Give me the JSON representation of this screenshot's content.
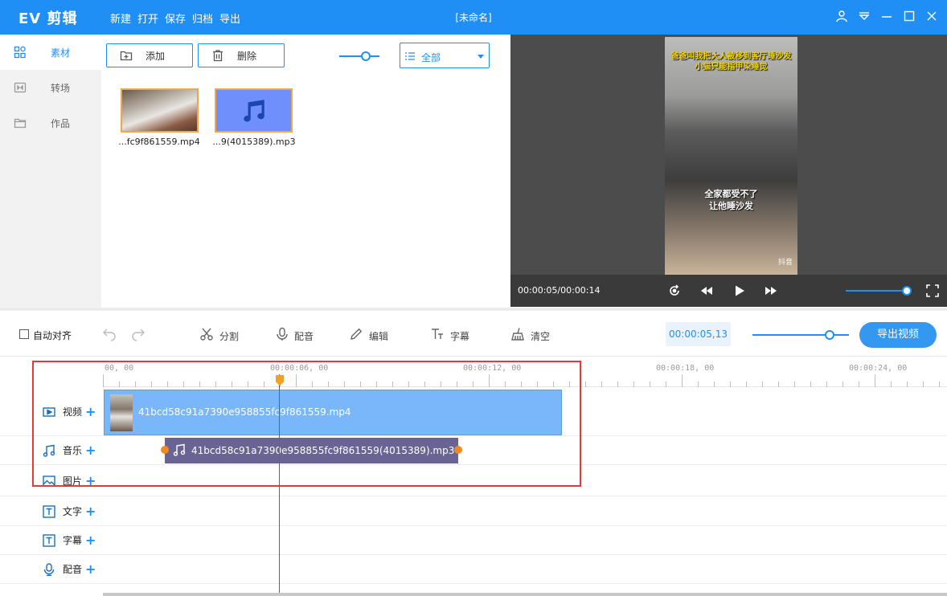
{
  "app": {
    "logo": "EV 剪辑",
    "doc_title": "[未命名]",
    "menu": [
      "新建",
      "打开",
      "保存",
      "归档",
      "导出"
    ]
  },
  "nav": {
    "items": [
      {
        "label": "素材",
        "icon": "grid-icon",
        "active": true
      },
      {
        "label": "转场",
        "icon": "transition-icon",
        "active": false
      },
      {
        "label": "作品",
        "icon": "folder-icon",
        "active": false
      }
    ]
  },
  "media": {
    "add_label": "添加",
    "delete_label": "删除",
    "filter_value": "全部",
    "thumb_size_level": 0.65,
    "files": [
      {
        "caption": "...fc9f861559.mp4",
        "type": "video"
      },
      {
        "caption": "...9(4015389).mp3",
        "type": "audio"
      }
    ]
  },
  "preview": {
    "caption_top": "爸爸叫我把大人被移到客厅睡沙发\n小猫只能指甲染睡觉",
    "caption_mid": "全家都受不了\n让他睡沙发",
    "watermark": "抖音",
    "time": "00:00:05/00:00:14",
    "volume_level": 0.95
  },
  "toolbar": {
    "auto_align_label": "自动对齐",
    "split_label": "分割",
    "voice_label": "配音",
    "edit_label": "编辑",
    "subtitle_label": "字幕",
    "clear_label": "清空",
    "timecode": "00:00:05,13",
    "zoom_level": 0.8,
    "export_label": "导出视频"
  },
  "timeline": {
    "ticks": [
      "00, 00",
      "00:00:06, 00",
      "00:00:12, 00",
      "00:00:18, 00",
      "00:00:24, 00"
    ],
    "tracks": [
      {
        "label": "视频",
        "icon": "video-track-icon"
      },
      {
        "label": "音乐",
        "icon": "music-note-icon"
      },
      {
        "label": "图片",
        "icon": "image-icon"
      },
      {
        "label": "文字",
        "icon": "text-icon"
      },
      {
        "label": "字幕",
        "icon": "subtitle-icon"
      },
      {
        "label": "配音",
        "icon": "microphone-icon"
      }
    ],
    "video_clip": "41bcd58c91a7390e958855fc9f861559.mp4",
    "audio_clip": "41bcd58c91a7390e958855fc9f861559(4015389).mp3",
    "playhead_time": "00:00:05,13"
  },
  "colors": {
    "brand": "#1f8ff5",
    "video_clip": "#79b7fa",
    "audio_clip": "#6a6495",
    "playhead": "#e03030",
    "highlight_box": "#e23a3a"
  }
}
